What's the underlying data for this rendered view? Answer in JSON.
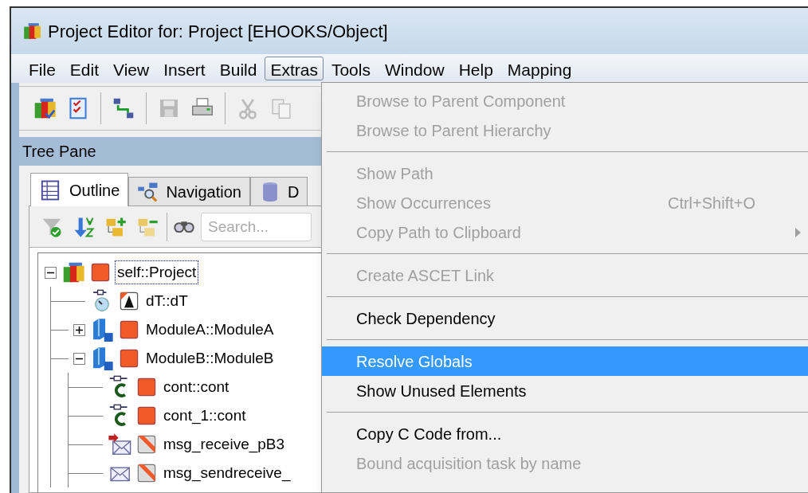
{
  "window": {
    "title": "Project Editor for: Project [EHOOKS/Object]"
  },
  "menu_bar": [
    {
      "label": "File",
      "selected": false
    },
    {
      "label": "Edit",
      "selected": false
    },
    {
      "label": "View",
      "selected": false
    },
    {
      "label": "Insert",
      "selected": false
    },
    {
      "label": "Build",
      "selected": false
    },
    {
      "label": "Extras",
      "selected": true
    },
    {
      "label": "Tools",
      "selected": false
    },
    {
      "label": "Window",
      "selected": false
    },
    {
      "label": "Help",
      "selected": false
    },
    {
      "label": "Mapping",
      "selected": false
    }
  ],
  "tree_pane": {
    "title": "Tree Pane",
    "tabs": [
      {
        "label": "Outline",
        "selected": true
      },
      {
        "label": "Navigation",
        "selected": false
      },
      {
        "label": "D",
        "selected": false
      }
    ],
    "search": {
      "placeholder": "Search..."
    },
    "tree": [
      {
        "label": "self::Project",
        "kind": "project",
        "expanded": true,
        "selected": true,
        "children": [
          {
            "label": "dT::dT",
            "kind": "timer",
            "selected": false
          },
          {
            "label": "ModuleA::ModuleA",
            "kind": "module",
            "expanded": false,
            "selected": false
          },
          {
            "label": "ModuleB::ModuleB",
            "kind": "module",
            "expanded": true,
            "selected": false,
            "children": [
              {
                "label": "cont::cont",
                "kind": "constant",
                "selected": false
              },
              {
                "label": "cont_1::cont",
                "kind": "constant",
                "selected": false
              },
              {
                "label": "msg_receive_pB3",
                "kind": "message_in",
                "selected": false
              },
              {
                "label": "msg_sendreceive_",
                "kind": "message",
                "selected": false
              }
            ]
          }
        ]
      }
    ]
  },
  "extras_menu": [
    {
      "kind": "item",
      "label": "Browse to Parent Component",
      "disabled": true,
      "selected": false
    },
    {
      "kind": "item",
      "label": "Browse to Parent Hierarchy",
      "disabled": true,
      "selected": false
    },
    {
      "kind": "separator"
    },
    {
      "kind": "item",
      "label": "Show Path",
      "disabled": true,
      "selected": false
    },
    {
      "kind": "item",
      "label": "Show Occurrences",
      "shortcut": "Ctrl+Shift+O",
      "disabled": true,
      "selected": false
    },
    {
      "kind": "item",
      "label": "Copy Path to Clipboard",
      "submenu": true,
      "disabled": true,
      "selected": false
    },
    {
      "kind": "separator"
    },
    {
      "kind": "item",
      "label": "Create ASCET Link",
      "disabled": true,
      "selected": false
    },
    {
      "kind": "separator"
    },
    {
      "kind": "item",
      "label": "Check Dependency",
      "disabled": false,
      "selected": false
    },
    {
      "kind": "separator"
    },
    {
      "kind": "item",
      "label": "Resolve Globals",
      "disabled": false,
      "selected": true
    },
    {
      "kind": "item",
      "label": "Show Unused Elements",
      "disabled": false,
      "selected": false
    },
    {
      "kind": "separator"
    },
    {
      "kind": "item",
      "label": "Copy C Code from...",
      "disabled": false,
      "selected": false
    },
    {
      "kind": "item",
      "label": "Bound acquisition task by name",
      "disabled": true,
      "selected": false
    }
  ]
}
